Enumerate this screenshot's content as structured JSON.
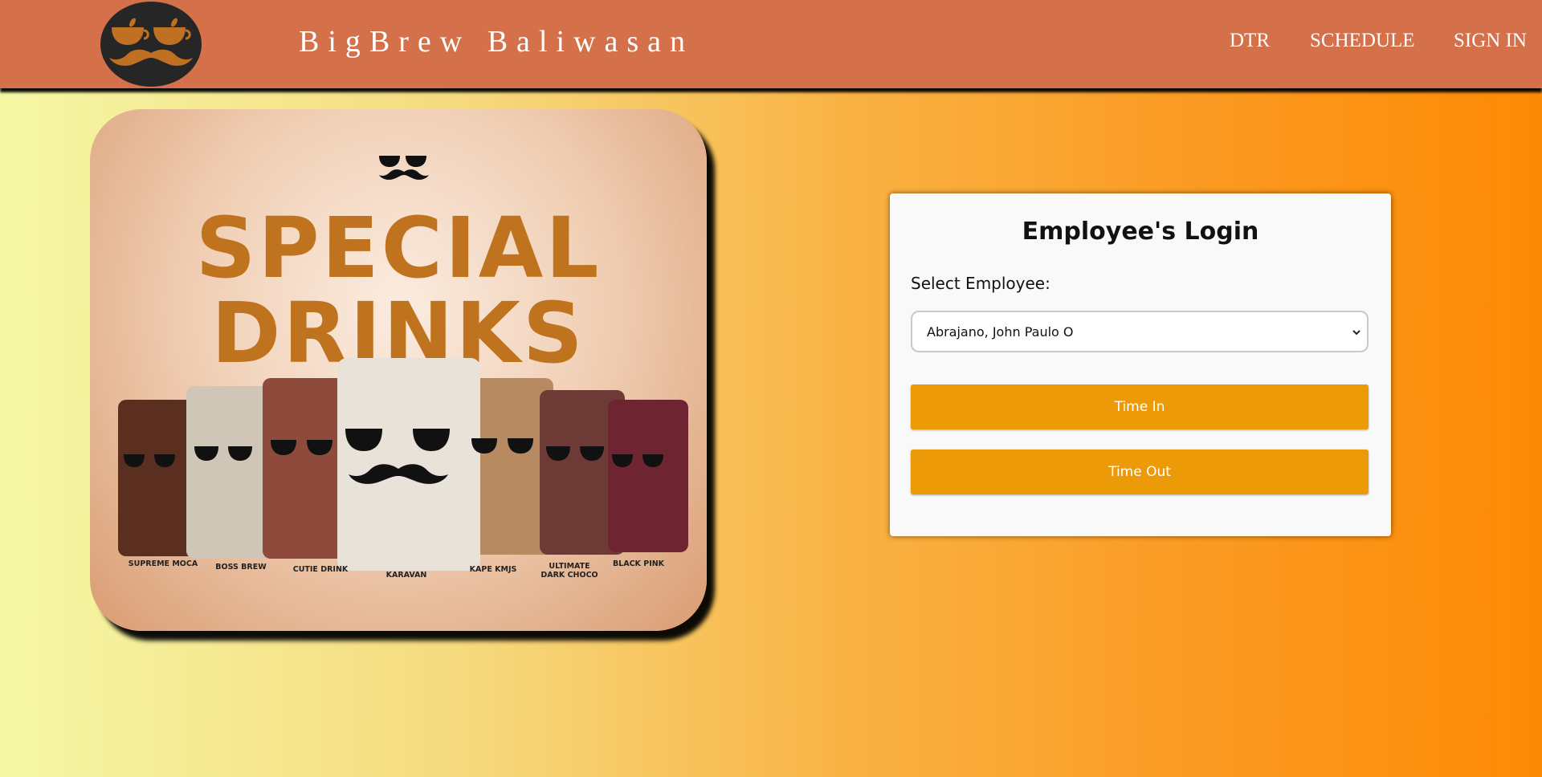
{
  "header": {
    "brand": "BigBrew Baliwasan",
    "nav": [
      {
        "label": "DTR"
      },
      {
        "label": "SCHEDULE"
      },
      {
        "label": "SIGN IN"
      }
    ]
  },
  "promo": {
    "headline_line1": "SPECIAL",
    "headline_line2": "DRINKS",
    "drinks": [
      {
        "label": "SUPREME MOCA"
      },
      {
        "label": "BOSS BREW"
      },
      {
        "label": "CUTIE DRINK"
      },
      {
        "label": "KARAVAN"
      },
      {
        "label": "KAPE KMJS"
      },
      {
        "label": "ULTIMATE\nDARK CHOCO"
      },
      {
        "label": "BLACK PINK"
      }
    ]
  },
  "login": {
    "title": "Employee's Login",
    "select_label": "Select Employee:",
    "selected_employee": "Abrajano, John Paulo O",
    "time_in_label": "Time In",
    "time_out_label": "Time Out"
  },
  "icons": {
    "logo": "coffee-cups-mustache-icon",
    "dropdown": "chevron-down-icon"
  },
  "colors": {
    "header": "#d4704a",
    "button": "#ec9a08",
    "gradient_start": "#f5f7a5",
    "gradient_end": "#fd8a04",
    "headline": "#c0731e"
  }
}
